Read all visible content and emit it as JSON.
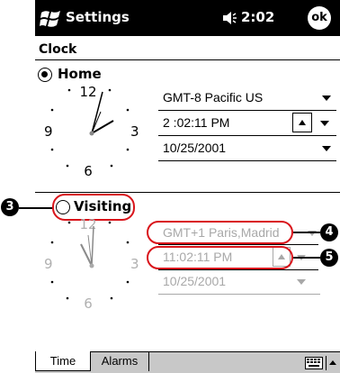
{
  "titlebar": {
    "title": "Settings",
    "time": "2:02",
    "ok_label": "ok",
    "icons": [
      "windows-flag-icon",
      "speaker-icon"
    ]
  },
  "page_title": "Clock",
  "home": {
    "label": "Home",
    "selected": true,
    "clock_numbers": [
      "12",
      "9",
      "3",
      "6"
    ],
    "time_zone": "GMT-8 Pacific US",
    "time": "2 :02:11 PM",
    "date": "10/25/2001"
  },
  "visiting": {
    "label": "Visiting",
    "selected": false,
    "clock_numbers": [
      "12",
      "9",
      "3",
      "6"
    ],
    "time_zone": "GMT+1 Paris,Madrid",
    "time": "11:02:11 PM",
    "date": "10/25/2001"
  },
  "callouts": {
    "visiting_radio": "3",
    "time_zone": "4",
    "time": "5"
  },
  "tabs": [
    {
      "label": "Time",
      "active": true
    },
    {
      "label": "Alarms",
      "active": false
    }
  ],
  "toolbar": {
    "icons": [
      "keyboard-icon",
      "up-arrow-icon"
    ]
  },
  "colors": {
    "highlight": "#d9141b",
    "disabled_text": "#a8a8a8",
    "toolbar_bg": "#c8c8c8"
  }
}
